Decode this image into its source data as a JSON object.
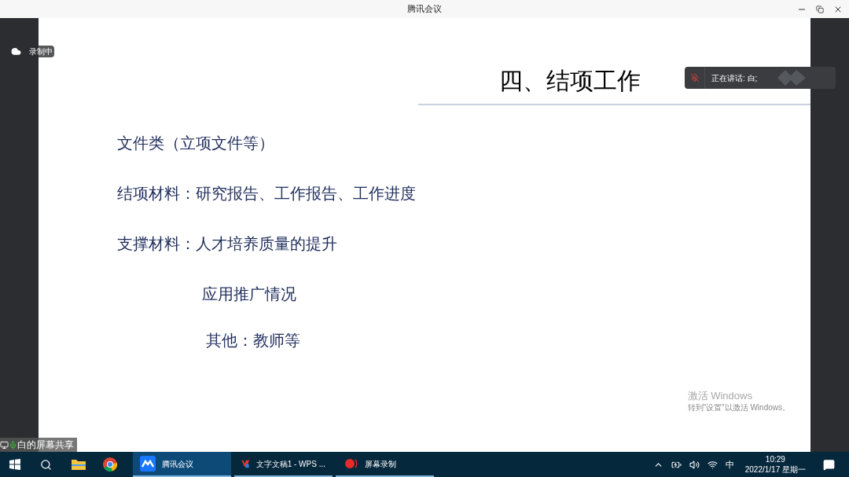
{
  "window": {
    "title": "腾讯会议"
  },
  "recording": {
    "label": "录制中"
  },
  "slide": {
    "title": "四、结项工作",
    "lines": [
      {
        "text": "文件类（立项文件等）",
        "kind": "item"
      },
      {
        "text": "结项材料：研究报告、工作报告、工作进度",
        "kind": "item"
      },
      {
        "text": "支撑材料：人才培养质量的提升",
        "kind": "item"
      },
      {
        "text": "应用推广情况",
        "kind": "sub"
      },
      {
        "text": "其他：教师等",
        "kind": "sub2"
      }
    ]
  },
  "speaker": {
    "label": "正在讲话: 白;",
    "muted": true
  },
  "share_label": "白的屏幕共享",
  "activation": {
    "title": "激活 Windows",
    "hint": "转到\"设置\"以激活 Windows。"
  },
  "taskbar": {
    "apps": [
      {
        "label": "腾讯会议",
        "kind": "meeting",
        "selected": true
      },
      {
        "label": "文字文稿1 - WPS ...",
        "kind": "wps",
        "selected": false
      },
      {
        "label": "屏幕录制",
        "kind": "record",
        "selected": false
      }
    ],
    "ime": "中",
    "time": "10:29",
    "date": "2022/1/17 星期一"
  }
}
